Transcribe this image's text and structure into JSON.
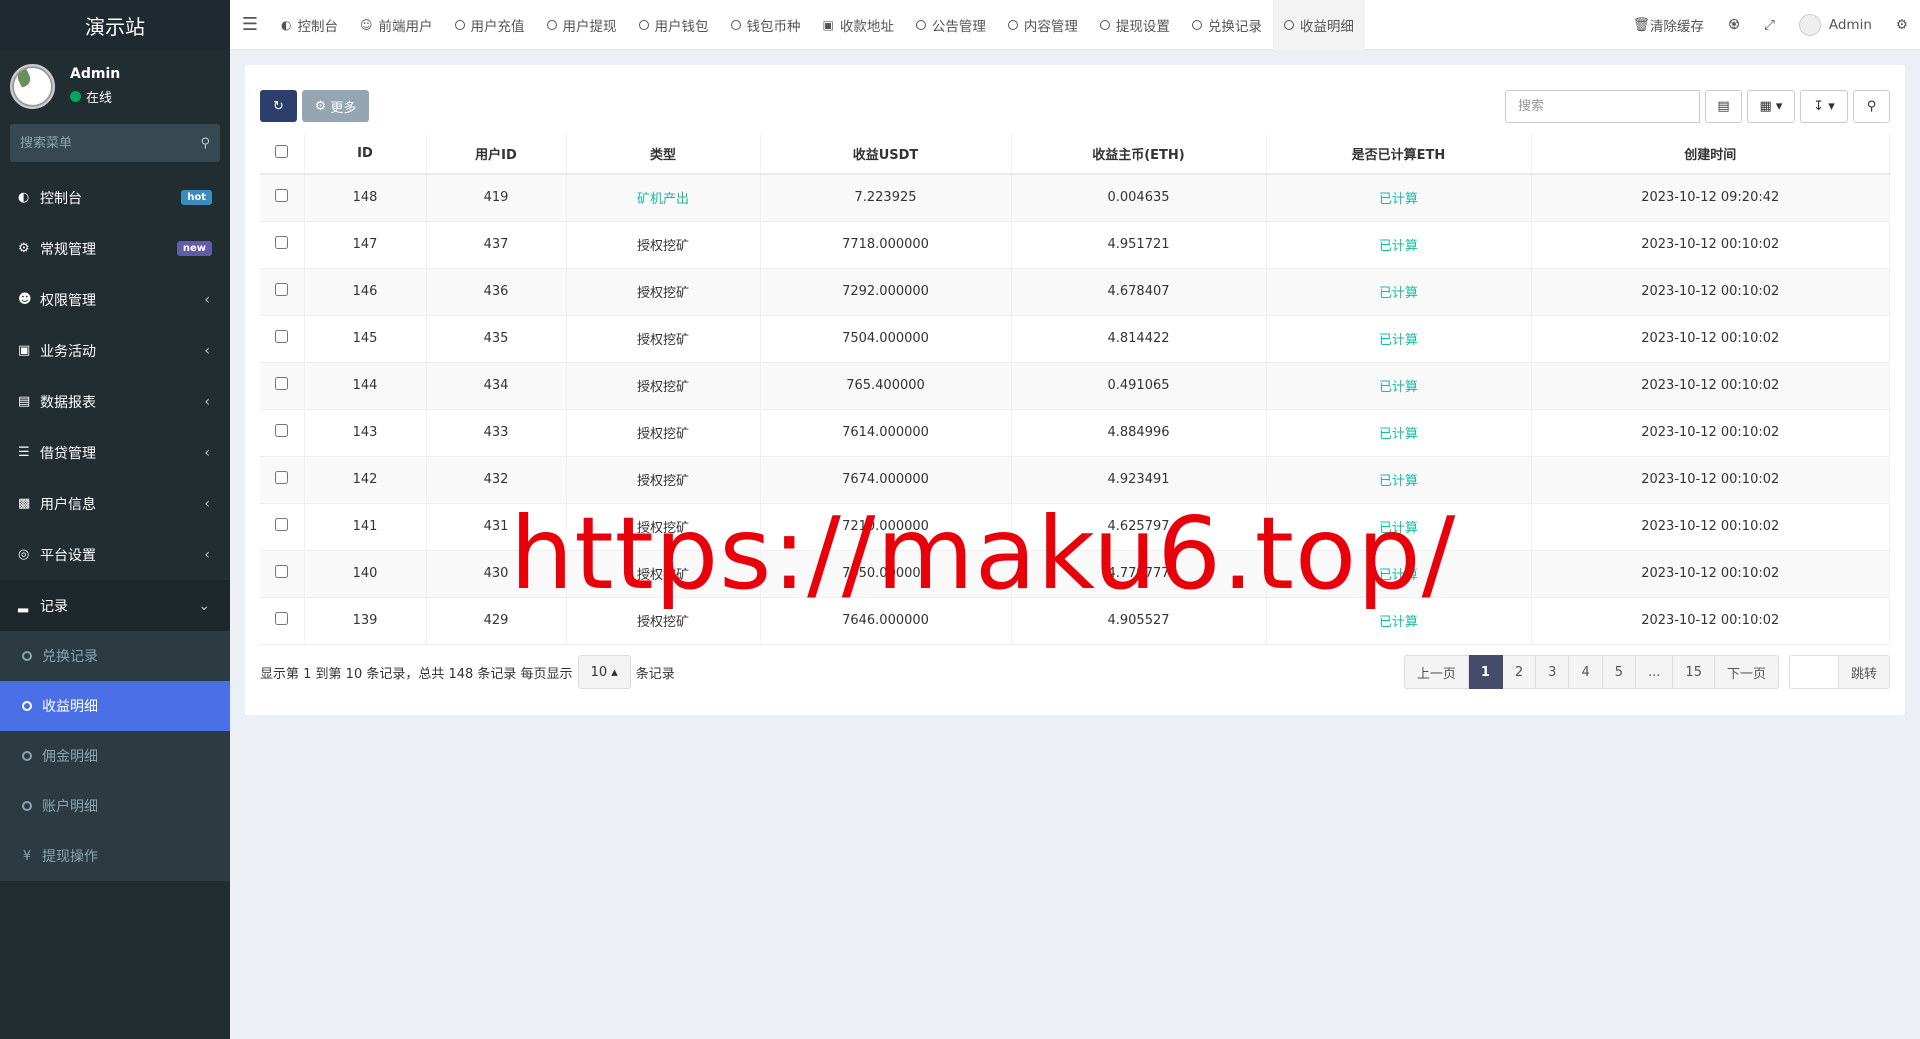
{
  "sidebar": {
    "logo": "演示站",
    "user": {
      "name": "Admin",
      "status": "在线"
    },
    "search_placeholder": "搜索菜单",
    "items": [
      {
        "label": "控制台",
        "icon": "dashboard-icon",
        "badge": "hot"
      },
      {
        "label": "常规管理",
        "icon": "cogs-icon",
        "badge": "new"
      },
      {
        "label": "权限管理",
        "icon": "group-icon"
      },
      {
        "label": "业务活动",
        "icon": "id-card-icon"
      },
      {
        "label": "数据报表",
        "icon": "file-icon"
      },
      {
        "label": "借贷管理",
        "icon": "list-icon"
      },
      {
        "label": "用户信息",
        "icon": "address-book-icon"
      },
      {
        "label": "平台设置",
        "icon": "circle-dot-icon"
      },
      {
        "label": "记录",
        "icon": "chart-icon"
      }
    ],
    "sub_items": [
      {
        "label": "兑换记录"
      },
      {
        "label": "收益明细"
      },
      {
        "label": "佣金明细"
      },
      {
        "label": "账户明细"
      },
      {
        "label": "提现操作"
      }
    ]
  },
  "navbar": {
    "tabs": [
      {
        "label": "控制台"
      },
      {
        "label": "前端用户"
      },
      {
        "label": "用户充值"
      },
      {
        "label": "用户提现"
      },
      {
        "label": "用户钱包"
      },
      {
        "label": "钱包币种"
      },
      {
        "label": "收款地址"
      },
      {
        "label": "公告管理"
      },
      {
        "label": "内容管理"
      },
      {
        "label": "提现设置"
      },
      {
        "label": "兑换记录"
      },
      {
        "label": "收益明细"
      }
    ],
    "clear_cache": "清除缓存",
    "admin": "Admin"
  },
  "toolbar": {
    "more_label": "更多",
    "search_placeholder": "搜索"
  },
  "table": {
    "headers": [
      "ID",
      "用户ID",
      "类型",
      "收益USDT",
      "收益主币(ETH)",
      "是否已计算ETH",
      "创建时间"
    ],
    "rows": [
      [
        "148",
        "419",
        "矿机产出",
        "7.223925",
        "0.004635",
        "已计算",
        "2023-10-12 09:20:42"
      ],
      [
        "147",
        "437",
        "授权挖矿",
        "7718.000000",
        "4.951721",
        "已计算",
        "2023-10-12 00:10:02"
      ],
      [
        "146",
        "436",
        "授权挖矿",
        "7292.000000",
        "4.678407",
        "已计算",
        "2023-10-12 00:10:02"
      ],
      [
        "145",
        "435",
        "授权挖矿",
        "7504.000000",
        "4.814422",
        "已计算",
        "2023-10-12 00:10:02"
      ],
      [
        "144",
        "434",
        "授权挖矿",
        "765.400000",
        "0.491065",
        "已计算",
        "2023-10-12 00:10:02"
      ],
      [
        "143",
        "433",
        "授权挖矿",
        "7614.000000",
        "4.884996",
        "已计算",
        "2023-10-12 00:10:02"
      ],
      [
        "142",
        "432",
        "授权挖矿",
        "7674.000000",
        "4.923491",
        "已计算",
        "2023-10-12 00:10:02"
      ],
      [
        "141",
        "431",
        "授权挖矿",
        "7210.000000",
        "4.625797",
        "已计算",
        "2023-10-12 00:10:02"
      ],
      [
        "140",
        "430",
        "授权挖矿",
        "7450.000000",
        "4.779777",
        "已计算",
        "2023-10-12 00:10:02"
      ],
      [
        "139",
        "429",
        "授权挖矿",
        "7646.000000",
        "4.905527",
        "已计算",
        "2023-10-12 00:10:02"
      ]
    ]
  },
  "footer": {
    "info": "显示第 1 到第 10 条记录，总共 148 条记录 每页显示",
    "page_size": "10",
    "suffix": "条记录",
    "pages": [
      "上一页",
      "1",
      "2",
      "3",
      "4",
      "5",
      "...",
      "15",
      "下一页"
    ],
    "go_label": "跳转"
  },
  "watermark": "https://maku6.top/",
  "colors": {
    "sidebar_bg": "#222d32",
    "active_sub": "#4a6fe6",
    "accent_green": "#18bc9c",
    "hot_badge": "#3c8dbc",
    "new_badge": "#605ca8"
  }
}
